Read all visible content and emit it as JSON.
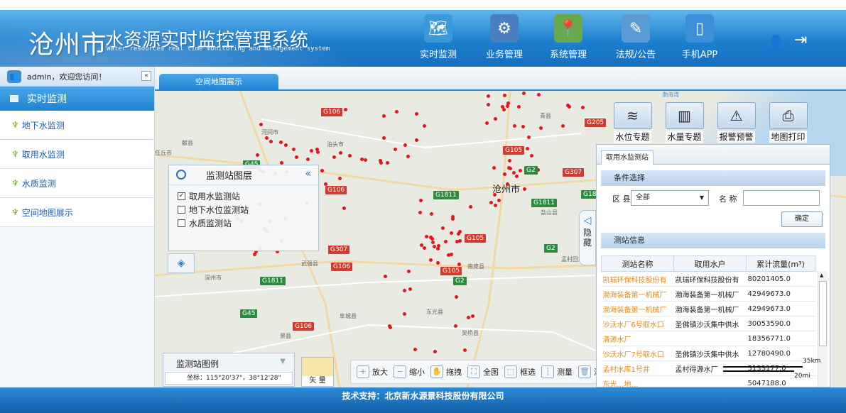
{
  "header": {
    "city": "沧州市",
    "title": "水资源实时监控管理系统",
    "subtitle": "Water resources real time monitoring and management system",
    "nav": [
      {
        "label": "实时监测",
        "icon": "globe-map-icon",
        "color": "#3a9ad9"
      },
      {
        "label": "业务管理",
        "icon": "gears-icon",
        "color": "#4a7fbf"
      },
      {
        "label": "系统管理",
        "icon": "map-pin-icon",
        "color": "#6aa84f"
      },
      {
        "label": "法规/公告",
        "icon": "document-pencil-icon",
        "color": "#5b9bd5"
      },
      {
        "label": "手机APP",
        "icon": "mobile-phone-icon",
        "color": "#3c8fd8"
      }
    ],
    "user_icon": "user-icon",
    "exit_icon": "logout-icon"
  },
  "sidebar": {
    "welcome": "admin，欢迎您访问！",
    "section": "实时监测",
    "items": [
      {
        "label": "地下水监测"
      },
      {
        "label": "取用水监测"
      },
      {
        "label": "水质监测"
      },
      {
        "label": "空间地图展示"
      }
    ]
  },
  "tabs": [
    "空间地图展示"
  ],
  "map": {
    "road_labels": [
      "G106",
      "G205",
      "G105",
      "G45",
      "G2",
      "G307",
      "G1811",
      "G18",
      "G106",
      "G105",
      "G1811",
      "G307",
      "G105",
      "G2",
      "G106",
      "G45",
      "G106",
      "G1811",
      "G2"
    ],
    "places": [
      "献县",
      "泊头市",
      "河间市",
      "青县",
      "深州市",
      "武强县",
      "阜城县",
      "东光县",
      "孟村回族自治县",
      "盐山县",
      "南皮县",
      "景县",
      "吴桥县",
      "渤海湾",
      "任丘市"
    ],
    "city": "沧州市",
    "layer_panel": {
      "title": "监测站图层",
      "layers": [
        {
          "label": "取用水监测站",
          "checked": true
        },
        {
          "label": "地下水位监测站",
          "checked": false
        },
        {
          "label": "水质监测站",
          "checked": false
        }
      ]
    },
    "legend": {
      "title": "监测站图例",
      "coord": "坐标：115°20'37\"，38°12'28\""
    },
    "vector_label": "矢 量",
    "toolbar": [
      {
        "label": "放大",
        "icon": "zoom-in-icon"
      },
      {
        "label": "缩小",
        "icon": "zoom-out-icon"
      },
      {
        "label": "拖拽",
        "icon": "hand-pan-icon"
      },
      {
        "label": "全图",
        "icon": "full-extent-icon"
      },
      {
        "label": "框选",
        "icon": "box-select-icon"
      },
      {
        "label": "测量",
        "icon": "ruler-icon"
      },
      {
        "label": "清除",
        "icon": "trash-icon"
      }
    ],
    "topics": [
      {
        "label": "水位专题",
        "icon": "water-level-icon"
      },
      {
        "label": "水量专题",
        "icon": "bar-chart-icon"
      },
      {
        "label": "报警预警",
        "icon": "alarm-icon"
      },
      {
        "label": "地图打印",
        "icon": "printer-icon"
      }
    ],
    "hide_label": "隐藏",
    "scale": {
      "km": "35km",
      "mi": "20mi"
    },
    "point_color": "#e8141b"
  },
  "panel": {
    "tab": "取用水监测站",
    "condition_title": "条件选择",
    "district_label": "区 县",
    "district_value": "全部",
    "name_label": "名 称",
    "name_value": "",
    "confirm": "确定",
    "info_title": "测站信息",
    "columns": [
      "测站名称",
      "取用水户",
      "累计流量(m³)"
    ],
    "rows": [
      [
        "凯瑞环保科技股份有",
        "凯瑞环保科技股份有",
        "80201405.0"
      ],
      [
        "渤海装备第一机械厂",
        "渤海装备第一机械厂",
        "42949673.0"
      ],
      [
        "渤海装备第一机械厂",
        "渤海装备第一机械厂",
        "42949673.0"
      ],
      [
        "沙沃水厂6号取水口",
        "圣佛镇沙沃集中供水",
        "30053590.0"
      ],
      [
        "清源水厂",
        "",
        "18356771.0"
      ],
      [
        "沙沃水厂7号取水口",
        "圣佛镇沙沃集中供水",
        "12780490.0"
      ],
      [
        "孟村水库1号井",
        "孟村得源水厂",
        "5133177.0"
      ],
      [
        "东光…地…",
        "",
        "5047188.0"
      ]
    ]
  },
  "footer": "技术支持：北京新水源景科技股份有限公司"
}
